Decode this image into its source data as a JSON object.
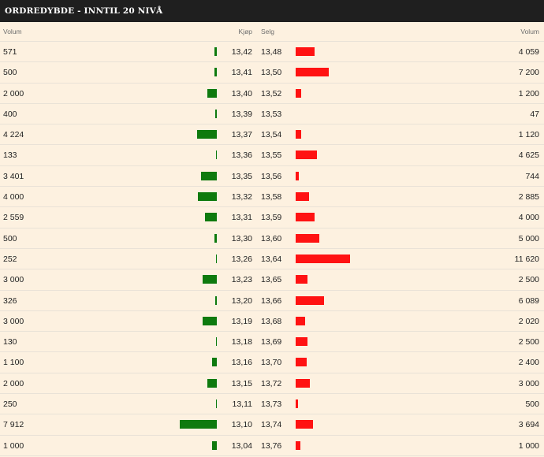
{
  "title": "ORDREDYBDE - INNTIL 20 NIVÅ",
  "columns": {
    "bid_volume": "Volum",
    "bid_price": "Kjøp",
    "ask_price": "Selg",
    "ask_volume": "Volum"
  },
  "colors": {
    "bid_bar": "#0e7a0e",
    "ask_bar": "#ff1212",
    "background": "#fdf1e0",
    "header_bg": "#1f1f1f"
  },
  "rows": [
    {
      "bid_volume": "571",
      "bid_price": "13,42",
      "ask_price": "13,48",
      "ask_volume": "4 059"
    },
    {
      "bid_volume": "500",
      "bid_price": "13,41",
      "ask_price": "13,50",
      "ask_volume": "7 200"
    },
    {
      "bid_volume": "2 000",
      "bid_price": "13,40",
      "ask_price": "13,52",
      "ask_volume": "1 200"
    },
    {
      "bid_volume": "400",
      "bid_price": "13,39",
      "ask_price": "13,53",
      "ask_volume": "47"
    },
    {
      "bid_volume": "4 224",
      "bid_price": "13,37",
      "ask_price": "13,54",
      "ask_volume": "1 120"
    },
    {
      "bid_volume": "133",
      "bid_price": "13,36",
      "ask_price": "13,55",
      "ask_volume": "4 625"
    },
    {
      "bid_volume": "3 401",
      "bid_price": "13,35",
      "ask_price": "13,56",
      "ask_volume": "744"
    },
    {
      "bid_volume": "4 000",
      "bid_price": "13,32",
      "ask_price": "13,58",
      "ask_volume": "2 885"
    },
    {
      "bid_volume": "2 559",
      "bid_price": "13,31",
      "ask_price": "13,59",
      "ask_volume": "4 000"
    },
    {
      "bid_volume": "500",
      "bid_price": "13,30",
      "ask_price": "13,60",
      "ask_volume": "5 000"
    },
    {
      "bid_volume": "252",
      "bid_price": "13,26",
      "ask_price": "13,64",
      "ask_volume": "11 620"
    },
    {
      "bid_volume": "3 000",
      "bid_price": "13,23",
      "ask_price": "13,65",
      "ask_volume": "2 500"
    },
    {
      "bid_volume": "326",
      "bid_price": "13,20",
      "ask_price": "13,66",
      "ask_volume": "6 089"
    },
    {
      "bid_volume": "3 000",
      "bid_price": "13,19",
      "ask_price": "13,68",
      "ask_volume": "2 020"
    },
    {
      "bid_volume": "130",
      "bid_price": "13,18",
      "ask_price": "13,69",
      "ask_volume": "2 500"
    },
    {
      "bid_volume": "1 100",
      "bid_price": "13,16",
      "ask_price": "13,70",
      "ask_volume": "2 400"
    },
    {
      "bid_volume": "2 000",
      "bid_price": "13,15",
      "ask_price": "13,72",
      "ask_volume": "3 000"
    },
    {
      "bid_volume": "250",
      "bid_price": "13,11",
      "ask_price": "13,73",
      "ask_volume": "500"
    },
    {
      "bid_volume": "7 912",
      "bid_price": "13,10",
      "ask_price": "13,74",
      "ask_volume": "3 694"
    },
    {
      "bid_volume": "1 000",
      "bid_price": "13,04",
      "ask_price": "13,76",
      "ask_volume": "1 000"
    }
  ]
}
